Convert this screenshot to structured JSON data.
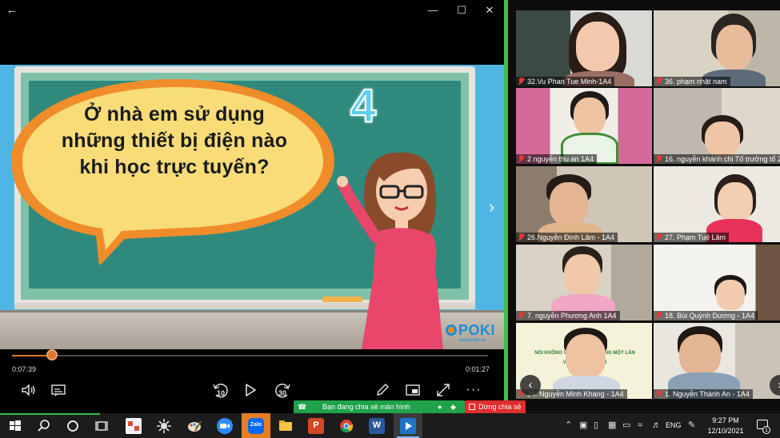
{
  "player": {
    "question_lines": [
      "Ở nhà em sử dụng",
      "những thiết bị điện nào",
      "khi học trực tuyến?"
    ],
    "slide_number": "4",
    "logo_text": "POKI",
    "logo_url": "www.poki.vn",
    "time_elapsed": "0:07:39",
    "time_remaining": "0:01:27",
    "progress_fraction": 0.084,
    "rewind_seconds": "10",
    "forward_seconds": "30",
    "more_label": "···"
  },
  "gallery": {
    "participants": [
      {
        "name": "32.Vu Phan Tue Minh-1A4"
      },
      {
        "name": "36. phạm nhật nam"
      },
      {
        "name": "2 nguyễn thu an 1A4"
      },
      {
        "name": "16. nguyễn khánh chi Tố trưởng tổ 2"
      },
      {
        "name": "26.Nguyễn Đình Lâm - 1A4"
      },
      {
        "name": "27. Phạm Tuệ Lâm"
      },
      {
        "name": "7. nguyễn Phương Anh 1A4"
      },
      {
        "name": "18. Bùi Quỳnh Dương - 1A4"
      },
      {
        "name": "24. Nguyễn Minh Khang - 1A4"
      },
      {
        "name": "1. Nguyễn Thành An - 1A4"
      }
    ],
    "banner_lines": [
      "NÓI KHÔNG VỚI ĐỒ NHỰA DÙNG MỘT LẦN",
      "VÌ VIỆT NAM XANH"
    ]
  },
  "share": {
    "status": "Bạn đang chia sẻ màn hình",
    "stop_label": "Dừng chia sẻ"
  },
  "taskbar": {
    "zalo_label": "Zalo",
    "language": "ENG",
    "time": "9:27 PM",
    "date": "12/10/2021",
    "notification_count": "1"
  },
  "colors": {
    "accent_orange": "#d9772c",
    "meeting_green": "#1fa34a",
    "stop_red": "#e02d2d",
    "sky": "#4fb6e4"
  }
}
